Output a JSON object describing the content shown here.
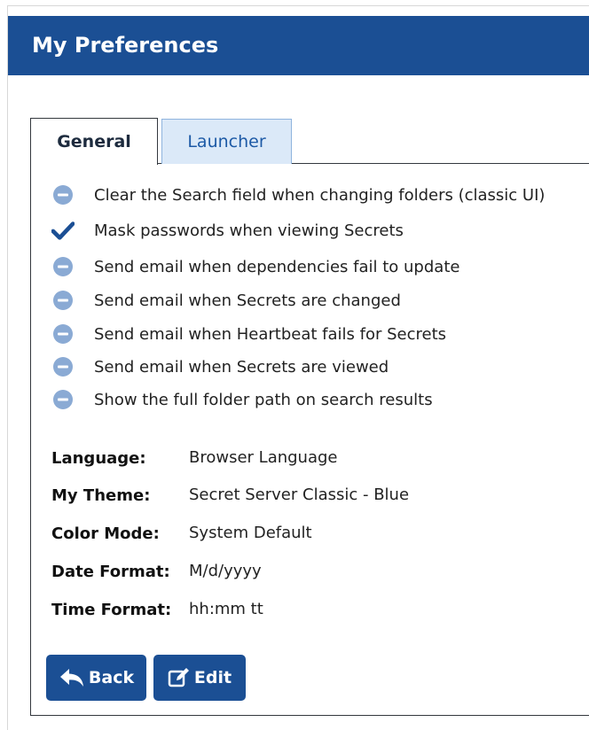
{
  "header": {
    "title": "My Preferences"
  },
  "tabs": [
    {
      "label": "General",
      "selected": true
    },
    {
      "label": "Launcher",
      "selected": false
    }
  ],
  "preferences": [
    {
      "label": "Clear the Search field when changing folders (classic UI)",
      "enabled": false,
      "icon": "minus-circle-icon"
    },
    {
      "label": "Mask passwords when viewing Secrets",
      "enabled": true,
      "icon": "check-icon"
    },
    {
      "label": "Send email when dependencies fail to update",
      "enabled": false,
      "icon": "minus-circle-icon"
    },
    {
      "label": "Send email when Secrets are changed",
      "enabled": false,
      "icon": "minus-circle-icon"
    },
    {
      "label": "Send email when Heartbeat fails for Secrets",
      "enabled": false,
      "icon": "minus-circle-icon"
    },
    {
      "label": "Send email when Secrets are viewed",
      "enabled": false,
      "icon": "minus-circle-icon"
    },
    {
      "label": "Show the full folder path on search results",
      "enabled": false,
      "icon": "minus-circle-icon"
    }
  ],
  "settings": [
    {
      "label": "Language",
      "value": "Browser Language"
    },
    {
      "label": "My Theme",
      "value": "Secret Server Classic - Blue"
    },
    {
      "label": "Color Mode",
      "value": "System Default"
    },
    {
      "label": "Date Format",
      "value": "M/d/yyyy"
    },
    {
      "label": "Time Format",
      "value": "hh:mm tt"
    }
  ],
  "buttons": {
    "back_label": "Back",
    "edit_label": "Edit"
  },
  "colors": {
    "header_bg": "#1b4f94",
    "button_bg": "#1b4f94",
    "disabled_icon": "#8aaad4",
    "check_icon": "#1b4f94",
    "inactive_tab_bg": "#dbe9f8"
  }
}
